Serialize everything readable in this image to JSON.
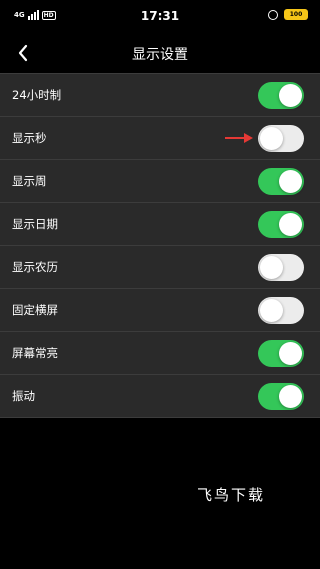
{
  "status_bar": {
    "network": "4G",
    "hd_label": "HD",
    "time": "17:31",
    "battery": "100",
    "alarm_icon": "alarm-clock-icon"
  },
  "nav": {
    "back_icon": "chevron-left-icon",
    "title": "显示设置"
  },
  "settings": [
    {
      "label": "24小时制",
      "on": true
    },
    {
      "label": "显示秒",
      "on": false
    },
    {
      "label": "显示周",
      "on": true
    },
    {
      "label": "显示日期",
      "on": true
    },
    {
      "label": "显示农历",
      "on": false
    },
    {
      "label": "固定横屏",
      "on": false
    },
    {
      "label": "屏幕常亮",
      "on": true
    },
    {
      "label": "振动",
      "on": true
    }
  ],
  "annotation": {
    "icon": "red-arrow-icon",
    "color": "#e53935"
  },
  "colors": {
    "toggle_on": "#34c759",
    "toggle_off": "#ececec",
    "list_background": "#2a2a2a",
    "page_background": "#000000"
  },
  "watermark": "飞鸟下载"
}
